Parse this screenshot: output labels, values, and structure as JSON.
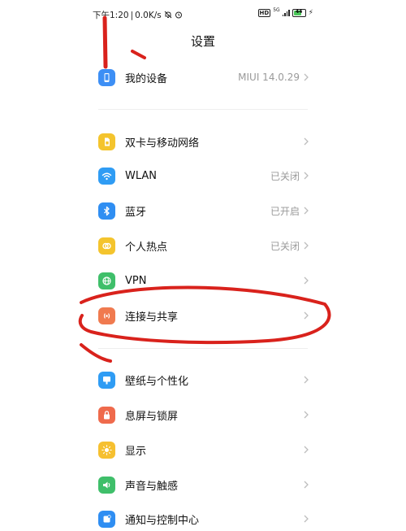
{
  "status_bar": {
    "time": "下午1:20",
    "speed": "0.0K/s",
    "network_badge": "HD",
    "network_type": "5G",
    "battery_level": "44",
    "icons": [
      "mute-icon",
      "alarm-icon",
      "signal-icon",
      "battery-icon",
      "charging-icon"
    ]
  },
  "page": {
    "title": "设置"
  },
  "groups": [
    {
      "items": [
        {
          "label": "我的设备",
          "value": "MIUI 14.0.29",
          "icon": "phone-icon",
          "color": "#3d8ff5"
        }
      ]
    },
    {
      "items": [
        {
          "label": "双卡与移动网络",
          "value": "",
          "icon": "sim-card-icon",
          "color": "#f4c42d"
        },
        {
          "label": "WLAN",
          "value": "已关闭",
          "icon": "wifi-icon",
          "color": "#2f9cf4"
        },
        {
          "label": "蓝牙",
          "value": "已开启",
          "icon": "bluetooth-icon",
          "color": "#2f8ef2"
        },
        {
          "label": "个人热点",
          "value": "已关闭",
          "icon": "hotspot-icon",
          "color": "#f4c42d"
        },
        {
          "label": "VPN",
          "value": "",
          "icon": "globe-icon",
          "color": "#3fbf6a"
        },
        {
          "label": "连接与共享",
          "value": "",
          "icon": "share-icon",
          "color": "#f07a4f"
        }
      ]
    },
    {
      "items": [
        {
          "label": "壁纸与个性化",
          "value": "",
          "icon": "wallpaper-icon",
          "color": "#2f9cf4"
        },
        {
          "label": "息屏与锁屏",
          "value": "",
          "icon": "lock-screen-icon",
          "color": "#ef6a4c"
        },
        {
          "label": "显示",
          "value": "",
          "icon": "sun-icon",
          "color": "#f6c030"
        },
        {
          "label": "声音与触感",
          "value": "",
          "icon": "speaker-icon",
          "color": "#3fbf6a"
        },
        {
          "label": "通知与控制中心",
          "value": "",
          "icon": "notification-icon",
          "color": "#2f8ef2"
        }
      ]
    }
  ],
  "annotation": {
    "color": "#d9221c"
  }
}
